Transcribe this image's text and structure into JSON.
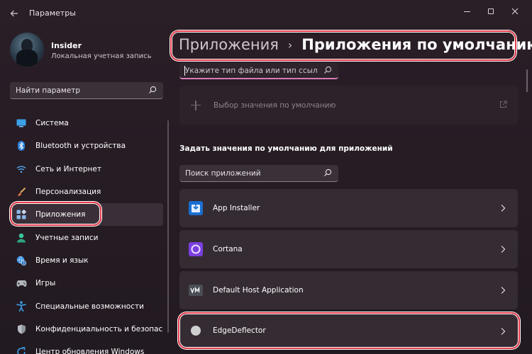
{
  "window": {
    "title": "Параметры"
  },
  "profile": {
    "name": "Insider",
    "account_type": "Локальная учетная запись"
  },
  "sidebar": {
    "search_placeholder": "Найти параметр",
    "items": [
      {
        "label": "Система",
        "icon": "monitor-icon"
      },
      {
        "label": "Bluetooth и устройства",
        "icon": "bluetooth-icon"
      },
      {
        "label": "Сеть и Интернет",
        "icon": "wifi-icon"
      },
      {
        "label": "Персонализация",
        "icon": "brush-icon"
      },
      {
        "label": "Приложения",
        "icon": "apps-icon",
        "selected": true
      },
      {
        "label": "Учетные записи",
        "icon": "person-icon"
      },
      {
        "label": "Время и язык",
        "icon": "globe-clock-icon"
      },
      {
        "label": "Игры",
        "icon": "gamepad-icon"
      },
      {
        "label": "Специальные возможности",
        "icon": "accessibility-icon"
      },
      {
        "label": "Конфиденциальность и безопасность",
        "icon": "shield-icon"
      },
      {
        "label": "Центр обновления Windows",
        "icon": "update-icon"
      }
    ]
  },
  "breadcrumb": {
    "parent": "Приложения",
    "separator": "›",
    "current": "Приложения по умолчанию"
  },
  "file_type_search": {
    "placeholder": "Укажите тип файла или тип ссылки"
  },
  "default_chooser": {
    "label": "Выбор значения по умолчанию"
  },
  "apps_section": {
    "title": "Задать значения по умолчанию для приложений",
    "search_placeholder": "Поиск приложений",
    "apps": [
      {
        "name": "App Installer",
        "icon": "app-installer-icon"
      },
      {
        "name": "Cortana",
        "icon": "cortana-icon"
      },
      {
        "name": "Default Host Application",
        "icon": "vm-icon"
      },
      {
        "name": "EdgeDeflector",
        "icon": "edgedeflector-icon"
      }
    ]
  },
  "colors": {
    "accent": "#d67bb6",
    "highlight": "#e33a4b",
    "background": "#231a21"
  }
}
